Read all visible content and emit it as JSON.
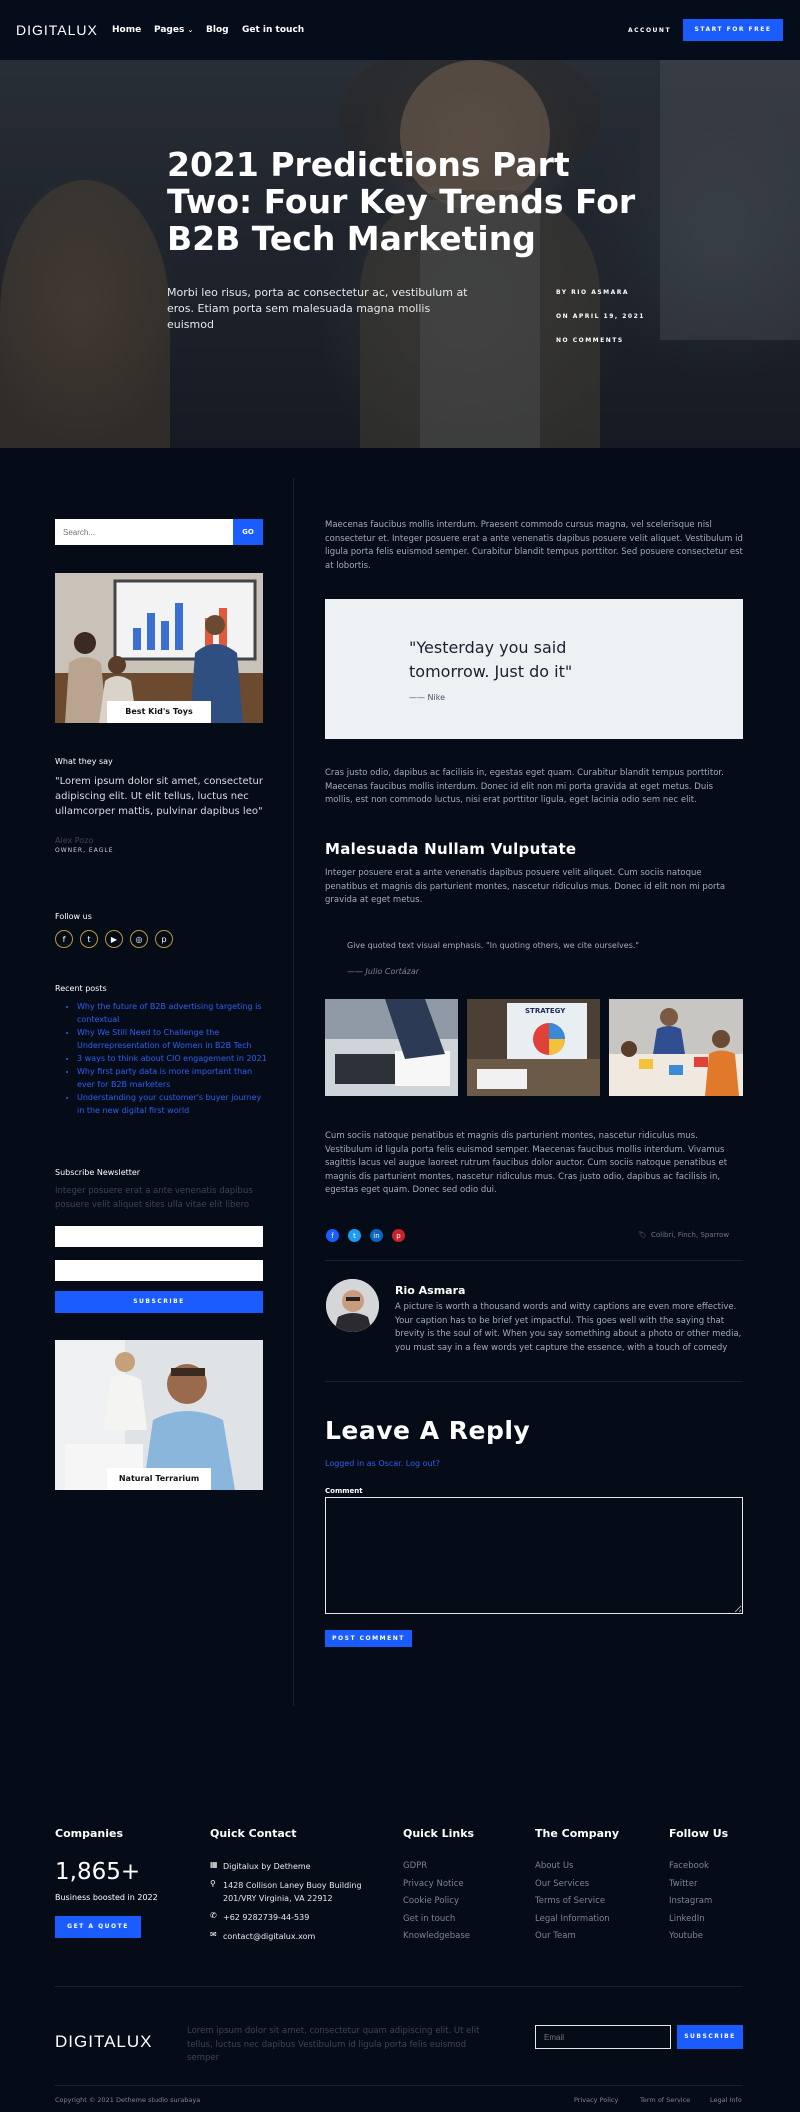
{
  "header": {
    "logo": "DIGITALUX",
    "nav": [
      "Home",
      "Pages",
      "Blog",
      "Get in touch"
    ],
    "account": "ACCOUNT",
    "cta": "START FOR FREE"
  },
  "hero": {
    "title": "2021 Predictions Part Two: Four Key Trends For B2B Tech Marketing",
    "subtitle": "Morbi leo risus, porta ac consectetur ac, vestibulum at eros. Etiam porta sem malesuada magna mollis euismod",
    "author": "BY RIO ASMARA",
    "date": "ON APRIL 19, 2021",
    "comments": "NO COMMENTS"
  },
  "sidebar": {
    "search_placeholder": "Search...",
    "search_button": "GO",
    "card1_caption": "Best Kid's Toys",
    "testimonial_heading": "What they say",
    "testimonial_quote": "\"Lorem ipsum dolor sit amet, consectetur adipiscing elit. Ut elit tellus, luctus nec ullamcorper mattis, pulvinar dapibus leo\"",
    "testimonial_name": "Alex Pozo",
    "testimonial_role": "OWNER, EAGLE",
    "follow_heading": "Follow us",
    "recent_heading": "Recent posts",
    "recent_posts": [
      "Why the future of B2B advertising targeting is contextual",
      "Why We Still Need to Challenge the Underrepresentation of Women in B2B Tech",
      "3 ways to think about CIO engagement in 2021",
      "Why first party data is more important than ever for B2B marketers",
      "Understanding your customer's buyer journey in the new digital first world"
    ],
    "newsletter_heading": "Subscribe Newsletter",
    "newsletter_text": "Integer posuere erat a ante venenatis dapibus posuere velit aliquet sites ulla vitae elit libero",
    "subscribe_button": "SUBSCRIBE",
    "card2_caption": "Natural Terrarium"
  },
  "article": {
    "p1": "Maecenas faucibus mollis interdum. Praesent commodo cursus magna, vel scelerisque nisl consectetur et. Integer posuere erat a ante venenatis dapibus posuere velit aliquet. Vestibulum id ligula porta felis euismod semper. Curabitur blandit tempus porttitor. Sed posuere consectetur est at lobortis.",
    "quote": "\"Yesterday you said tomorrow. Just do it\"",
    "quote_author": "—— Nike",
    "p2": "Cras justo odio, dapibus ac facilisis in, egestas eget quam. Curabitur blandit tempus porttitor. Maecenas faucibus mollis interdum. Donec id elit non mi porta gravida at eget metus. Duis mollis, est non commodo luctus, nisi erat porttitor ligula, eget lacinia odio sem nec elit.",
    "h2": "Malesuada Nullam Vulputate",
    "p3": "Integer posuere erat a ante venenatis dapibus posuere velit aliquet. Cum sociis natoque penatibus et magnis dis parturient montes, nascetur ridiculus mus. Donec id elit non mi porta gravida at eget metus.",
    "blockquote": "Give quoted text visual emphasis. \"In quoting others, we cite ourselves.\"",
    "blockquote_author": "—— Julio Cortázar",
    "photo2_label": "STRATEGY",
    "p4": "Cum sociis natoque penatibus et magnis dis parturient montes, nascetur ridiculus mus. Vestibulum id ligula porta felis euismod semper. Maecenas faucibus mollis interdum. Vivamus sagittis lacus vel augue laoreet rutrum faucibus dolor auctor. Cum sociis natoque penatibus et magnis dis parturient montes, nascetur ridiculus mus. Cras justo odio, dapibus ac facilisis in, egestas eget quam. Donec sed odio dui.",
    "tags": "Colibri, Finch, Sparrow"
  },
  "author_box": {
    "name": "Rio Asmara",
    "bio": "A picture is worth a thousand words and witty captions are even more effective. Your caption has to be brief yet impactful. This goes well with the saying that brevity is the soul of wit. When you say something about a photo or other media, you must say in a few words yet capture the essence, with a touch of comedy"
  },
  "reply": {
    "title": "Leave A Reply",
    "logged_in": "Logged in as Oscar. Log out?",
    "comment_label": "Comment",
    "post_button": "POST COMMENT"
  },
  "footer": {
    "companies_heading": "Companies",
    "stat": "1,865+",
    "stat_label": "Business boosted in 2022",
    "quote_button": "GET A QUOTE",
    "contact_heading": "Quick Contact",
    "contact_company": "Digitalux by Detheme",
    "contact_address": "1428 Collison Laney Buoy Building 201/VRY Virginia, VA 22912",
    "contact_phone": "+62 9282739-44-539",
    "contact_email": "contact@digitalux.xom",
    "links_heading": "Quick Links",
    "links": [
      "GDPR",
      "Privacy Notice",
      "Cookie Policy",
      "Get in touch",
      "Knowledgebase"
    ],
    "company_heading": "The Company",
    "company_links": [
      "About Us",
      "Our Services",
      "Terms of Service",
      "Legal Information",
      "Our Team"
    ],
    "follow_heading": "Follow Us",
    "follow_links": [
      "Facebook",
      "Twitter",
      "Instagram",
      "LinkedIn",
      "Youtube"
    ],
    "logo": "DIGITALUX",
    "about": "Lorem ipsum dolor sit amet, consectetur quam adipiscing elit. Ut elit tellus, luctus nec dapibus Vestibulum id ligula porta felis euismod semper",
    "email_placeholder": "Email",
    "subscribe": "SUBSCRIBE",
    "copyright": "Copyright © 2021 Detheme studio surabaya",
    "bottom_links": [
      "Privacy Policy",
      "Term of Service",
      "Legal Info"
    ]
  },
  "colors": {
    "accent": "#1a5cff",
    "background": "#050c18",
    "link": "#2f5ff0"
  }
}
